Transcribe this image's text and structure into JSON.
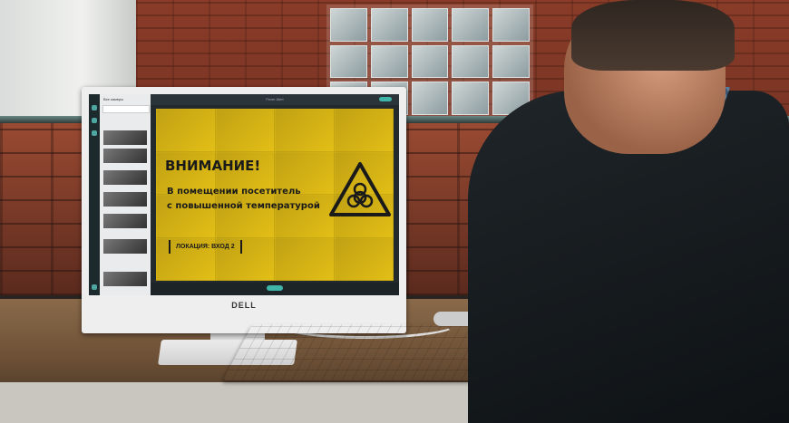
{
  "screen": {
    "app_title": "Fever Alert",
    "sidebar_title": "Все камеры",
    "alert": {
      "heading": "ВНИМАНИЕ!",
      "line1": "В помещении посетитель",
      "line2": "с повышенной температурой",
      "location": "ЛОКАЦИЯ: ВХОД 2"
    },
    "accent_color": "#3fb4a8",
    "alert_color": "#e3bf16"
  },
  "hardware": {
    "brand": "DELL"
  }
}
